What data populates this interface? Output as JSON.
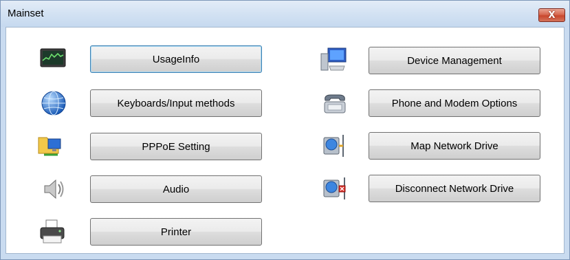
{
  "window": {
    "title": "Mainset",
    "close_glyph": "X"
  },
  "left_items": [
    {
      "label": "UsageInfo",
      "icon": "performance-monitor-icon"
    },
    {
      "label": "Keyboards/Input methods",
      "icon": "globe-icon"
    },
    {
      "label": "PPPoE Setting",
      "icon": "network-connections-icon"
    },
    {
      "label": "Audio",
      "icon": "speaker-icon"
    },
    {
      "label": "Printer",
      "icon": "printer-icon"
    }
  ],
  "right_items": [
    {
      "label": "Device Management",
      "icon": "computer-icon"
    },
    {
      "label": "Phone and Modem Options",
      "icon": "telephone-icon"
    },
    {
      "label": "Map Network Drive",
      "icon": "network-drive-icon"
    },
    {
      "label": "Disconnect Network Drive",
      "icon": "disconnect-network-drive-icon"
    }
  ],
  "colors": {
    "focus_border": "#3c7fb1",
    "title_bar": "#d3e2f3",
    "close_button": "#d76a51"
  }
}
